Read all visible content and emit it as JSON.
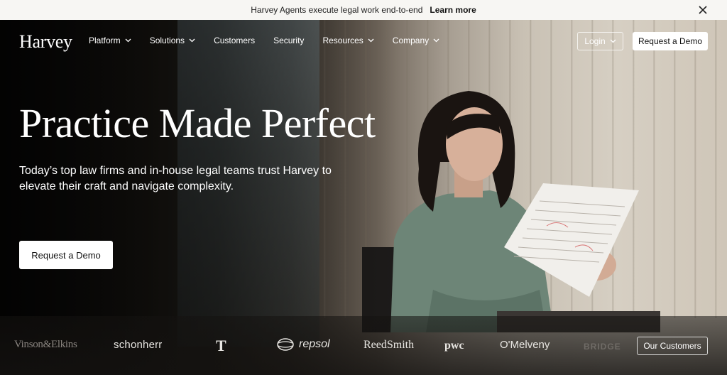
{
  "announcement": {
    "message": "Harvey Agents execute legal work end-to-end",
    "link_label": "Learn more",
    "close_icon": "close-icon"
  },
  "nav": {
    "logo": "Harvey",
    "items": [
      {
        "label": "Platform",
        "has_dropdown": true
      },
      {
        "label": "Solutions",
        "has_dropdown": true
      },
      {
        "label": "Customers",
        "has_dropdown": false
      },
      {
        "label": "Security",
        "has_dropdown": false
      },
      {
        "label": "Resources",
        "has_dropdown": true
      },
      {
        "label": "Company",
        "has_dropdown": true
      }
    ],
    "login_label": "Login",
    "demo_label": "Request a Demo"
  },
  "hero": {
    "headline": "Practice Made Perfect",
    "subtext": "Today’s top law firms and in-house legal teams trust Harvey to elevate their craft and navigate complexity.",
    "cta_label": "Request a Demo"
  },
  "clients": {
    "logos": [
      "Vinson&Elkins",
      "schonherr",
      "T",
      "repsol",
      "ReedSmith",
      "pwc",
      "O'Melveny",
      "BRIDGE"
    ],
    "cta_label": "Our Customers"
  },
  "colors": {
    "accent": "#ffffff",
    "announcement_bg": "#f7f6f3",
    "text_dark": "#111111"
  }
}
